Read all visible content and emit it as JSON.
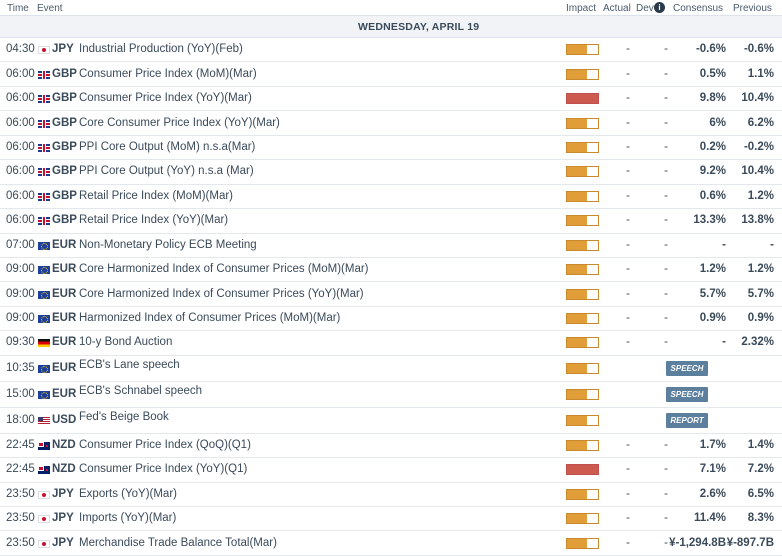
{
  "header": {
    "time": "Time",
    "event": "Event",
    "impact": "Impact",
    "actual": "Actual",
    "dev": "Dev",
    "info": "i",
    "consensus": "Consensus",
    "previous": "Previous"
  },
  "day_label": "WEDNESDAY, APRIL 19",
  "colors": {
    "impact_medium": "#e09d38",
    "impact_high": "#cc5a4f",
    "tag": "#5d7f9e"
  },
  "rows": [
    {
      "time": "04:30",
      "cur": "JPY",
      "flag": "jp",
      "event": "Industrial Production (YoY)(Feb)",
      "impact": "medium",
      "actual": "-",
      "dev": "-",
      "cons": "-0.6%",
      "prev": "-0.6%"
    },
    {
      "time": "06:00",
      "cur": "GBP",
      "flag": "gb",
      "event": "Consumer Price Index (MoM)(Mar)",
      "impact": "medium",
      "actual": "-",
      "dev": "-",
      "cons": "0.5%",
      "prev": "1.1%"
    },
    {
      "time": "06:00",
      "cur": "GBP",
      "flag": "gb",
      "event": "Consumer Price Index (YoY)(Mar)",
      "impact": "high",
      "actual": "-",
      "dev": "-",
      "cons": "9.8%",
      "prev": "10.4%"
    },
    {
      "time": "06:00",
      "cur": "GBP",
      "flag": "gb",
      "event": "Core Consumer Price Index (YoY)(Mar)",
      "impact": "medium",
      "actual": "-",
      "dev": "-",
      "cons": "6%",
      "prev": "6.2%"
    },
    {
      "time": "06:00",
      "cur": "GBP",
      "flag": "gb",
      "event": "PPI Core Output (MoM) n.s.a(Mar)",
      "impact": "medium",
      "actual": "-",
      "dev": "-",
      "cons": "0.2%",
      "prev": "-0.2%"
    },
    {
      "time": "06:00",
      "cur": "GBP",
      "flag": "gb",
      "event": "PPI Core Output (YoY) n.s.a (Mar)",
      "impact": "medium",
      "actual": "-",
      "dev": "-",
      "cons": "9.2%",
      "prev": "10.4%"
    },
    {
      "time": "06:00",
      "cur": "GBP",
      "flag": "gb",
      "event": "Retail Price Index (MoM)(Mar)",
      "impact": "medium",
      "actual": "-",
      "dev": "-",
      "cons": "0.6%",
      "prev": "1.2%"
    },
    {
      "time": "06:00",
      "cur": "GBP",
      "flag": "gb",
      "event": "Retail Price Index (YoY)(Mar)",
      "impact": "medium",
      "actual": "-",
      "dev": "-",
      "cons": "13.3%",
      "prev": "13.8%"
    },
    {
      "time": "07:00",
      "cur": "EUR",
      "flag": "eu",
      "event": "Non-Monetary Policy ECB Meeting",
      "impact": "medium",
      "actual": "-",
      "dev": "-",
      "cons": "-",
      "prev": "-"
    },
    {
      "time": "09:00",
      "cur": "EUR",
      "flag": "eu",
      "event": "Core Harmonized Index of Consumer Prices (MoM)(Mar)",
      "impact": "medium",
      "actual": "-",
      "dev": "-",
      "cons": "1.2%",
      "prev": "1.2%"
    },
    {
      "time": "09:00",
      "cur": "EUR",
      "flag": "eu",
      "event": "Core Harmonized Index of Consumer Prices (YoY)(Mar)",
      "impact": "medium",
      "actual": "-",
      "dev": "-",
      "cons": "5.7%",
      "prev": "5.7%"
    },
    {
      "time": "09:00",
      "cur": "EUR",
      "flag": "eu",
      "event": "Harmonized Index of Consumer Prices (MoM)(Mar)",
      "impact": "medium",
      "actual": "-",
      "dev": "-",
      "cons": "0.9%",
      "prev": "0.9%"
    },
    {
      "time": "09:30",
      "cur": "EUR",
      "flag": "de",
      "event": "10-y Bond Auction",
      "impact": "medium",
      "actual": "-",
      "dev": "-",
      "cons": "-",
      "prev": "2.32%"
    },
    {
      "time": "10:35",
      "cur": "EUR",
      "flag": "eu",
      "event": "ECB's Lane speech",
      "impact": "medium",
      "tag": "SPEECH",
      "tall": true
    },
    {
      "time": "15:00",
      "cur": "EUR",
      "flag": "eu",
      "event": "ECB's Schnabel speech",
      "impact": "medium",
      "tag": "SPEECH",
      "tall": true
    },
    {
      "time": "18:00",
      "cur": "USD",
      "flag": "us",
      "event": "Fed's Beige Book",
      "impact": "medium",
      "tag": "REPORT",
      "tall": true
    },
    {
      "time": "22:45",
      "cur": "NZD",
      "flag": "nz",
      "event": "Consumer Price Index (QoQ)(Q1)",
      "impact": "medium",
      "actual": "-",
      "dev": "-",
      "cons": "1.7%",
      "prev": "1.4%"
    },
    {
      "time": "22:45",
      "cur": "NZD",
      "flag": "nz",
      "event": "Consumer Price Index (YoY)(Q1)",
      "impact": "high",
      "actual": "-",
      "dev": "-",
      "cons": "7.1%",
      "prev": "7.2%"
    },
    {
      "time": "23:50",
      "cur": "JPY",
      "flag": "jp",
      "event": "Exports (YoY)(Mar)",
      "impact": "medium",
      "actual": "-",
      "dev": "-",
      "cons": "2.6%",
      "prev": "6.5%"
    },
    {
      "time": "23:50",
      "cur": "JPY",
      "flag": "jp",
      "event": "Imports (YoY)(Mar)",
      "impact": "medium",
      "actual": "-",
      "dev": "-",
      "cons": "11.4%",
      "prev": "8.3%"
    },
    {
      "time": "23:50",
      "cur": "JPY",
      "flag": "jp",
      "event": "Merchandise Trade Balance Total(Mar)",
      "impact": "medium",
      "actual": "-",
      "dev": "-",
      "cons": "¥-1,294.8B",
      "prev": "¥-897.7B"
    }
  ]
}
